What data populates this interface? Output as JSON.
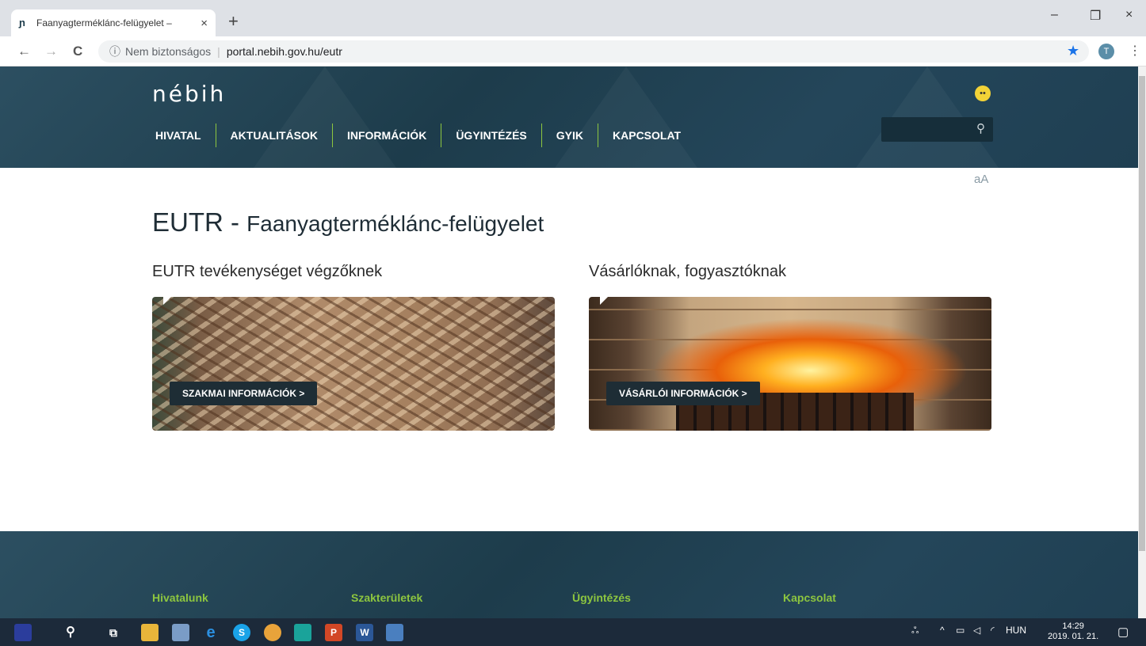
{
  "browser": {
    "tab_title": "Faanyagtermék­lánc-felügyelet – ",
    "tab_close": "×",
    "new_tab": "+",
    "window_minimize": "–",
    "window_restore": "❐",
    "window_close": "×",
    "back": "←",
    "forward": "→",
    "reload": "C",
    "insecure_label": "Nem biztonságos",
    "url": "portal.nebih.gov.hu/eutr",
    "profile_initial": "T"
  },
  "header": {
    "logo": "nébih",
    "nav": [
      "HIVATAL",
      "AKTUALITÁSOK",
      "INFORMÁCIÓK",
      "ÜGYINTÉZÉS",
      "GYIK",
      "KAPCSOLAT"
    ],
    "font_size_toggle": "aA"
  },
  "main": {
    "title_abbr": "EUTR - ",
    "title_rest": "Faanyagtermékl­ánc-felügyelet",
    "cards": [
      {
        "heading": "EUTR tevékenységet végzőknek",
        "button": "SZAKMAI INFORMÁCIÓK >"
      },
      {
        "heading": "Vásárlóknak, fogyasztóknak",
        "button": "VÁSÁRLÓI INFORMÁCIÓK >"
      }
    ]
  },
  "footer": {
    "columns": [
      "Hivatalunk",
      "Szakterületek",
      "Ügyintézés",
      "Kapcsolat"
    ]
  },
  "taskbar": {
    "language": "HUN",
    "time": "14:29",
    "date": "2019. 01. 21."
  },
  "colors": {
    "header_bg": "#1d3c4b",
    "accent_green": "#8dc63f",
    "button_dark": "#1e2d35"
  }
}
